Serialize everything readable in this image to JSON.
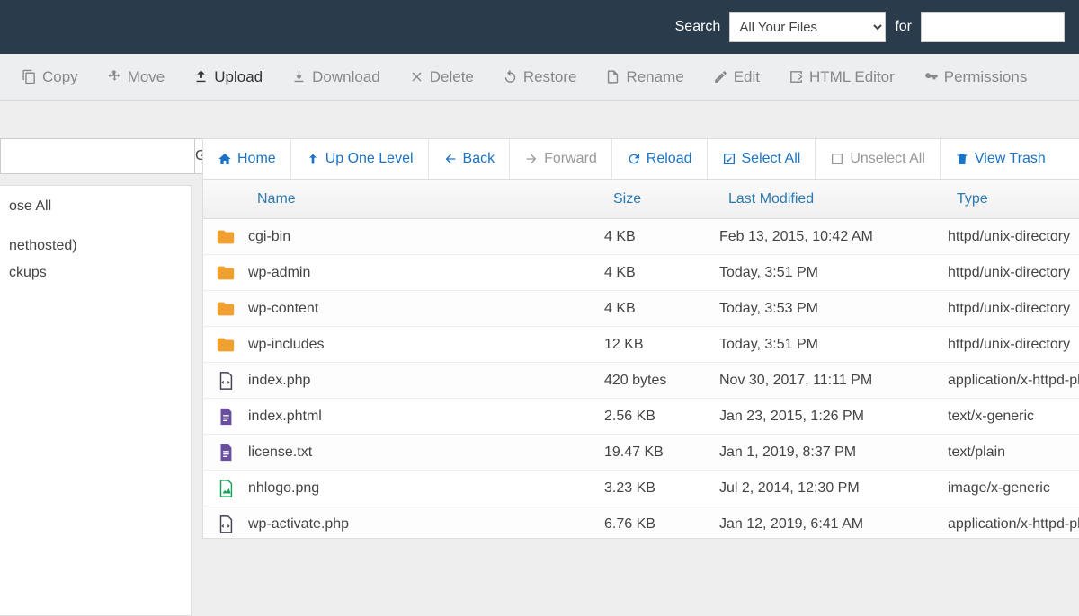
{
  "topbar": {
    "search_label": "Search",
    "scope_selected": "All Your Files",
    "for_label": "for",
    "query": ""
  },
  "toolbar": {
    "copy": "Copy",
    "move": "Move",
    "upload": "Upload",
    "download": "Download",
    "delete": "Delete",
    "restore": "Restore",
    "rename": "Rename",
    "edit": "Edit",
    "html_editor": "HTML Editor",
    "permissions": "Permissions"
  },
  "sidebar": {
    "go": "Go",
    "items": [
      {
        "label": "ose All"
      },
      {
        "label": "nethosted)"
      },
      {
        "label": "ckups"
      }
    ]
  },
  "navbar": {
    "home": "Home",
    "up": "Up One Level",
    "back": "Back",
    "forward": "Forward",
    "reload": "Reload",
    "select_all": "Select All",
    "unselect_all": "Unselect All",
    "view_trash": "View Trash"
  },
  "table": {
    "headers": {
      "name": "Name",
      "size": "Size",
      "modified": "Last Modified",
      "type": "Type"
    },
    "rows": [
      {
        "icon": "folder",
        "name": "cgi-bin",
        "size": "4 KB",
        "modified": "Feb 13, 2015, 10:42 AM",
        "type": "httpd/unix-directory"
      },
      {
        "icon": "folder",
        "name": "wp-admin",
        "size": "4 KB",
        "modified": "Today, 3:51 PM",
        "type": "httpd/unix-directory"
      },
      {
        "icon": "folder",
        "name": "wp-content",
        "size": "4 KB",
        "modified": "Today, 3:53 PM",
        "type": "httpd/unix-directory"
      },
      {
        "icon": "folder",
        "name": "wp-includes",
        "size": "12 KB",
        "modified": "Today, 3:51 PM",
        "type": "httpd/unix-directory"
      },
      {
        "icon": "php",
        "name": "index.php",
        "size": "420 bytes",
        "modified": "Nov 30, 2017, 11:11 PM",
        "type": "application/x-httpd-php"
      },
      {
        "icon": "doc",
        "name": "index.phtml",
        "size": "2.56 KB",
        "modified": "Jan 23, 2015, 1:26 PM",
        "type": "text/x-generic"
      },
      {
        "icon": "doc",
        "name": "license.txt",
        "size": "19.47 KB",
        "modified": "Jan 1, 2019, 8:37 PM",
        "type": "text/plain"
      },
      {
        "icon": "img",
        "name": "nhlogo.png",
        "size": "3.23 KB",
        "modified": "Jul 2, 2014, 12:30 PM",
        "type": "image/x-generic"
      },
      {
        "icon": "php",
        "name": "wp-activate.php",
        "size": "6.76 KB",
        "modified": "Jan 12, 2019, 6:41 AM",
        "type": "application/x-httpd-php"
      }
    ]
  }
}
